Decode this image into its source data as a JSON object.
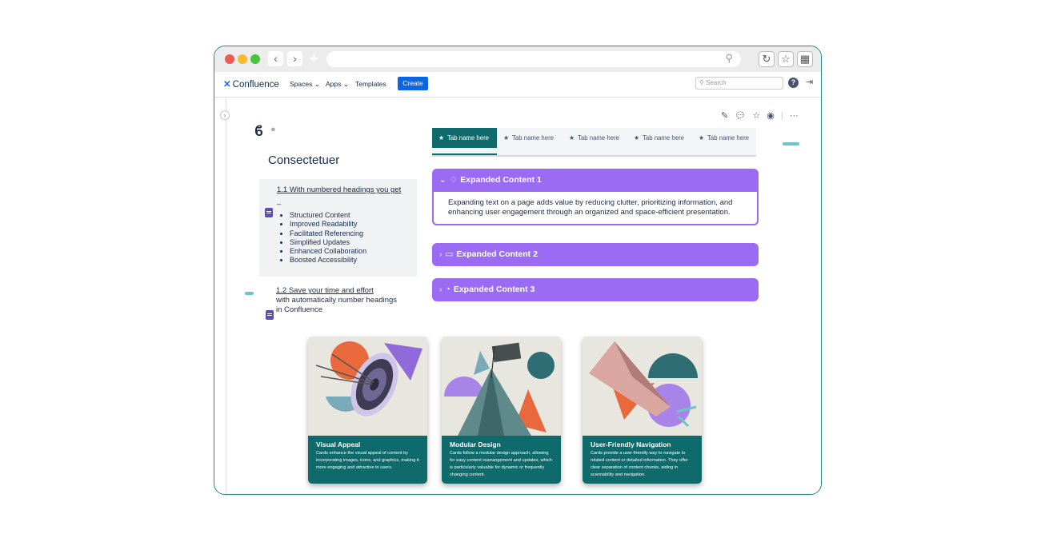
{
  "app": {
    "logo_label": "Confluence",
    "nav": {
      "spaces": "Spaces",
      "apps": "Apps",
      "templates": "Templates",
      "create": "Create"
    },
    "search_placeholder": "Search"
  },
  "page": {
    "title": "Consectetuer",
    "toc": {
      "heading1": "1.1 With numbered headings you get",
      "dash": "_",
      "items": [
        "Structured Content",
        "Improved Readability",
        "Facilitated Referencing",
        "Simplified Updates",
        "Enhanced Collaboration",
        "Boosted Accessibility"
      ],
      "heading2": "1.2 Save your time and effort",
      "heading2_line2": "with automatically number headings",
      "heading2_line3": "in Confluence"
    },
    "tabs": [
      "Tab name here",
      "Tab name here",
      "Tab name here",
      "Tab name here",
      "Tab name here"
    ],
    "expands": [
      {
        "title": "Expanded Content 1",
        "expanded": true,
        "body": "Expanding text on a page adds value by reducing clutter, prioritizing information, and enhancing user engagement through an organized and space-efficient presentation."
      },
      {
        "title": "Expanded Content 2",
        "expanded": false
      },
      {
        "title": "Expanded Content 3",
        "expanded": false
      }
    ],
    "cards": [
      {
        "title": "Visual Appeal",
        "text": "Cards enhance the visual appeal of content by incorporating images, icons, and graphics, making it more engaging and attractive to users."
      },
      {
        "title": "Modular Design",
        "text": "Cards follow a modular design approach, allowing for easy content rearrangement and updates, which is particularly valuable for dynamic or frequently changing content."
      },
      {
        "title": "User-Friendly Navigation",
        "text": "Cards provide a user-friendly way to navigate to related content or detailed information. They offer clear separation of content chunks, aiding in scannability and navigation."
      }
    ]
  },
  "colors": {
    "accent_teal": "#0f6b6b",
    "expand_purple": "#9b6cf3",
    "create_blue": "#0c66e4"
  }
}
